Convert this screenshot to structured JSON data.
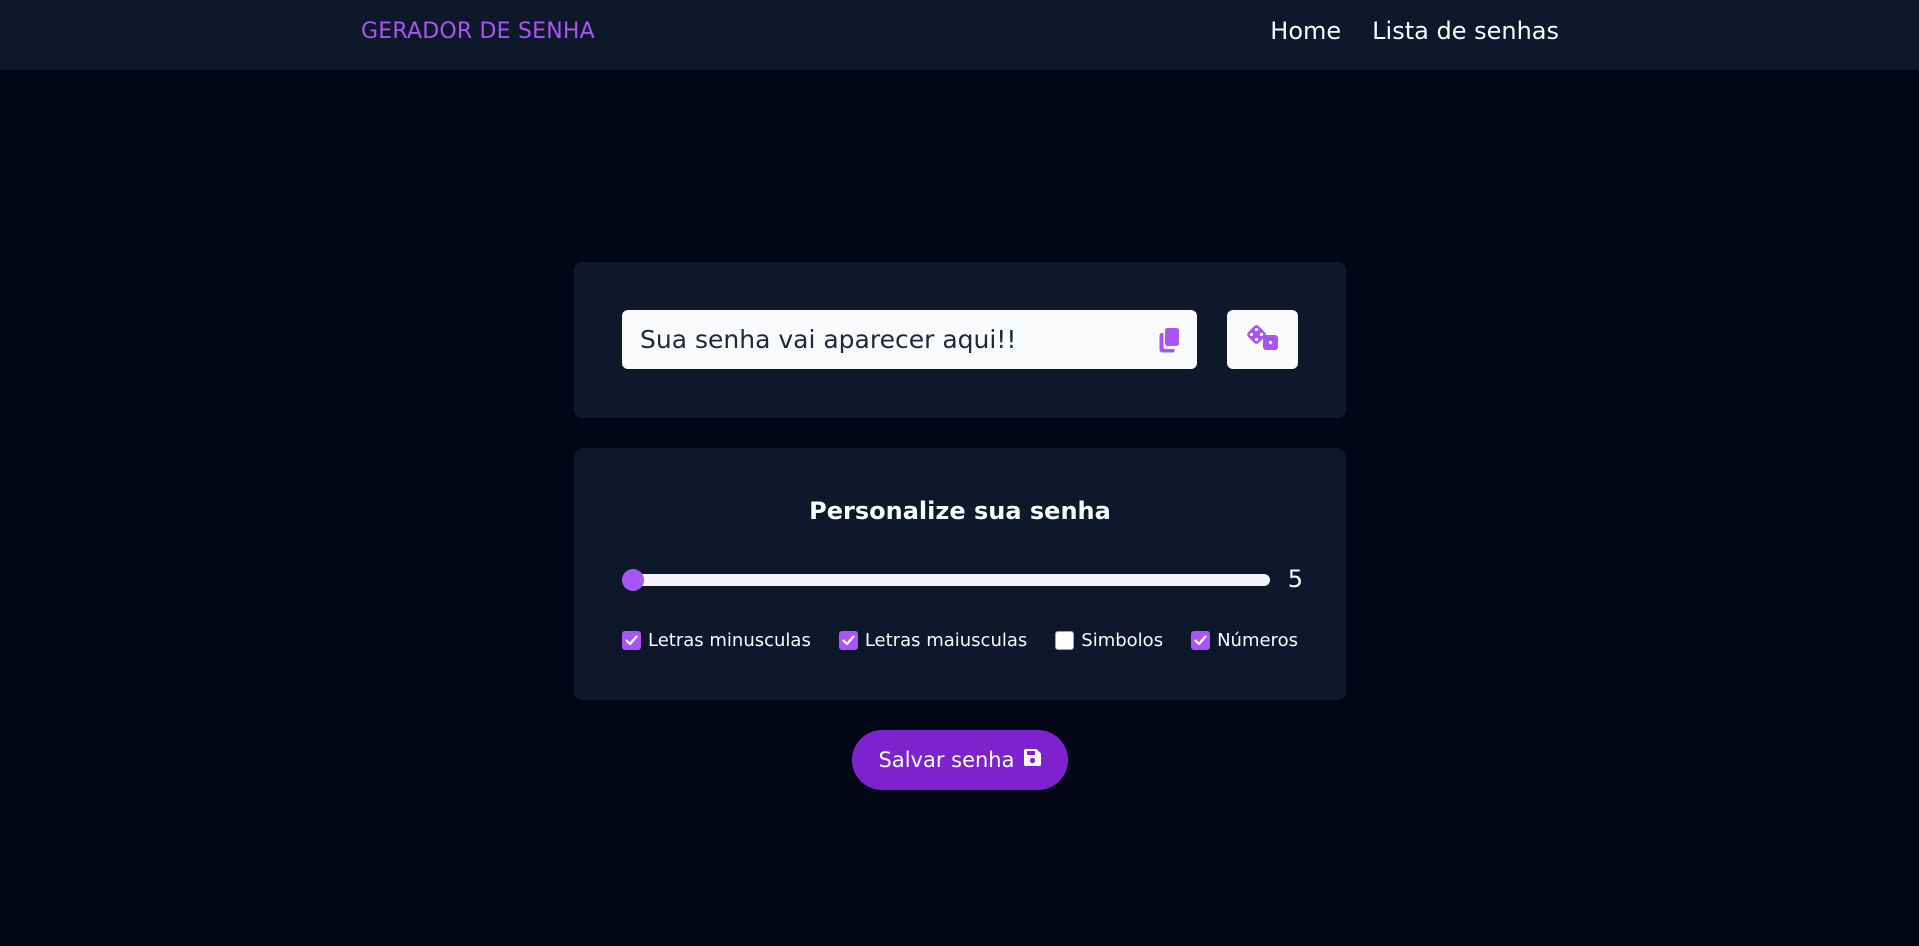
{
  "navbar": {
    "brand": "GERADOR DE SENHA",
    "links": [
      {
        "label": "Home"
      },
      {
        "label": "Lista de senhas"
      }
    ]
  },
  "password": {
    "placeholder": "Sua senha vai aparecer aqui!!",
    "value": "",
    "copy_icon": "copy-icon",
    "generate_icon": "dice-icon"
  },
  "options": {
    "title": "Personalize sua senha",
    "length": {
      "value": "5",
      "fraction": 0
    },
    "checkboxes": [
      {
        "label": "Letras minusculas",
        "checked": true
      },
      {
        "label": "Letras maiusculas",
        "checked": true
      },
      {
        "label": "Simbolos",
        "checked": false
      },
      {
        "label": "Números",
        "checked": true
      }
    ]
  },
  "save_button": {
    "label": "Salvar senha",
    "icon": "floppy-disk-icon"
  },
  "colors": {
    "background": "#020617",
    "surface": "#0f172a",
    "accent": "#a855f7",
    "button": "#7e22ce",
    "text": "#f8fafc"
  }
}
